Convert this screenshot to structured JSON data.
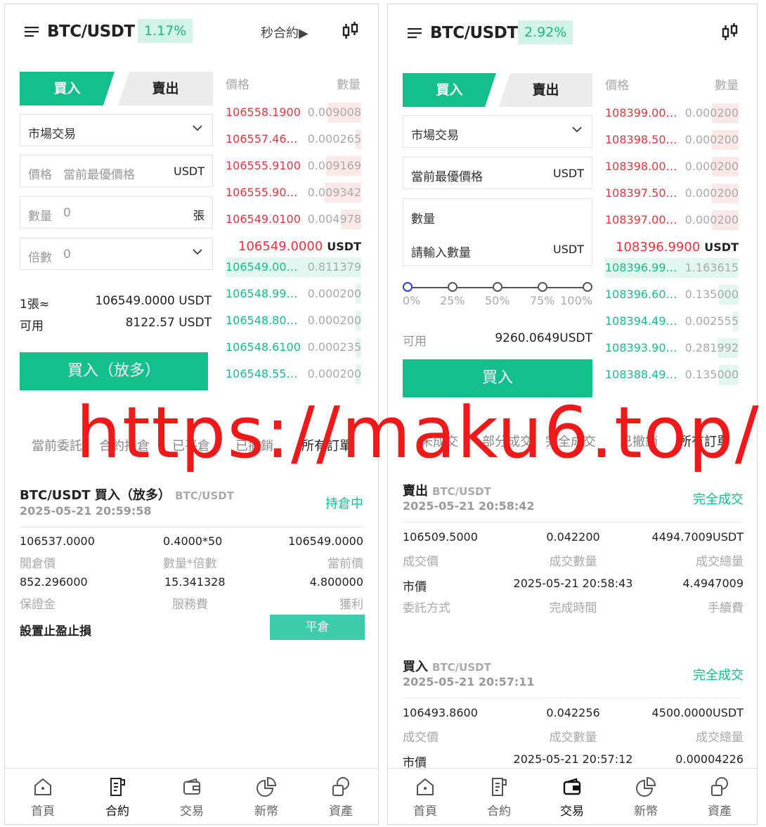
{
  "left": {
    "header": {
      "pair": "BTC/USDT",
      "change": "1.17%",
      "secondary": "秒合約",
      "secondary_arrow": "▶"
    },
    "tabs": {
      "buy": "買入",
      "sell": "賣出"
    },
    "form": {
      "order_type": "市場交易",
      "price_label": "價格",
      "price_value": "當前最優價格",
      "price_unit": "USDT",
      "qty_label": "數量",
      "qty_value": "0",
      "qty_unit": "張",
      "leverage_label": "倍數",
      "leverage_value": "0"
    },
    "info": {
      "lot_label": "1張≈",
      "lot_value": "106549.0000 USDT",
      "avail_label": "可用",
      "avail_value": "8122.57 USDT"
    },
    "submit": "買入（放多）",
    "orderbook": {
      "price_header": "價格",
      "qty_header": "數量",
      "asks": [
        {
          "price": "106558.1900",
          "qty": "0.009008",
          "depth": 0.25
        },
        {
          "price": "106557.46…",
          "qty": "0.000265",
          "depth": 0.04
        },
        {
          "price": "106555.9100",
          "qty": "0.009169",
          "depth": 0.26
        },
        {
          "price": "106555.90…",
          "qty": "0.009342",
          "depth": 0.27
        },
        {
          "price": "106549.0100",
          "qty": "0.004978",
          "depth": 0.15
        }
      ],
      "mid_price": "106549.0000",
      "mid_unit": "USDT",
      "bids": [
        {
          "price": "106549.00…",
          "qty": "0.811379",
          "depth": 1.0
        },
        {
          "price": "106548.99…",
          "qty": "0.000200",
          "depth": 0.03
        },
        {
          "price": "106548.80…",
          "qty": "0.000200",
          "depth": 0.03
        },
        {
          "price": "106548.6100",
          "qty": "0.000235",
          "depth": 0.03
        },
        {
          "price": "106548.55…",
          "qty": "0.000200",
          "depth": 0.03
        }
      ]
    },
    "subtabs": [
      "當前委託",
      "合約持倉",
      "已平倉",
      "已撤銷",
      "所有訂單"
    ],
    "order": {
      "title": "BTC/USDT 買入（放多）",
      "pair": "BTC/USDT",
      "date": "2025-05-21 20:59:58",
      "status": "持倉中",
      "r1": [
        "106537.0000",
        "0.4000*50",
        "106549.0000"
      ],
      "r1l": [
        "開倉價",
        "數量*倍數",
        "當前價"
      ],
      "r2": [
        "852.296000",
        "15.341328",
        "4.800000"
      ],
      "r2l": [
        "保證金",
        "服務費",
        "獲利"
      ],
      "tpsl": "設置止盈止損",
      "close": "平倉"
    },
    "nav": [
      "首頁",
      "合約",
      "交易",
      "新幣",
      "資產"
    ]
  },
  "right": {
    "header": {
      "pair": "BTC/USDT",
      "change": "2.92%"
    },
    "tabs": {
      "buy": "買入",
      "sell": "賣出"
    },
    "form": {
      "order_type": "市場交易",
      "price_value": "當前最優價格",
      "price_unit": "USDT",
      "qty_label": "數量",
      "qty_placeholder": "請輸入數量",
      "qty_unit": "USDT"
    },
    "slider": {
      "marks": [
        "0%",
        "25%",
        "50%",
        "75%",
        "100%"
      ],
      "value": 0
    },
    "info": {
      "avail_label": "可用",
      "avail_value": "9260.0649USDT"
    },
    "submit": "買入",
    "orderbook": {
      "price_header": "價格",
      "qty_header": "數量",
      "asks": [
        {
          "price": "108399.00…",
          "qty": "0.000200",
          "depth": 0.2
        },
        {
          "price": "108398.50…",
          "qty": "0.000200",
          "depth": 0.2
        },
        {
          "price": "108398.00…",
          "qty": "0.000200",
          "depth": 0.2
        },
        {
          "price": "108397.50…",
          "qty": "0.000200",
          "depth": 0.2
        },
        {
          "price": "108397.00…",
          "qty": "0.000200",
          "depth": 0.2
        }
      ],
      "mid_price": "108396.9900",
      "mid_unit": "USDT",
      "bids": [
        {
          "price": "108396.99…",
          "qty": "1.163615",
          "depth": 1.0
        },
        {
          "price": "108396.60…",
          "qty": "0.135000",
          "depth": 0.15
        },
        {
          "price": "108394.49…",
          "qty": "0.002555",
          "depth": 0.03
        },
        {
          "price": "108393.90…",
          "qty": "0.281992",
          "depth": 0.16
        },
        {
          "price": "108388.49…",
          "qty": "0.135000",
          "depth": 0.15
        }
      ]
    },
    "subtabs": [
      "未成交",
      "部分成交",
      "完全成交",
      "已撤銷",
      "所有訂單"
    ],
    "orders": [
      {
        "title": "賣出",
        "pair": "BTC/USDT",
        "date": "2025-05-21 20:58:42",
        "status": "完全成交",
        "r1": [
          "106509.5000",
          "0.042200",
          "4494.7009USDT"
        ],
        "r1l": [
          "成交價",
          "成交數量",
          "成交總量"
        ],
        "r2": [
          "市價",
          "2025-05-21 20:58:43",
          "4.4947009"
        ],
        "r2l": [
          "委託方式",
          "完成時間",
          "手續費"
        ]
      },
      {
        "title": "買入",
        "pair": "BTC/USDT",
        "date": "2025-05-21 20:57:11",
        "status": "完全成交",
        "r1": [
          "106493.8600",
          "0.042256",
          "4500.0000USDT"
        ],
        "r1l": [
          "成交價",
          "成交數量",
          "成交總量"
        ],
        "r2": [
          "市價",
          "2025-05-21 20:57:12",
          "0.00004226"
        ]
      }
    ],
    "nav": [
      "首頁",
      "合約",
      "交易",
      "新幣",
      "資產"
    ]
  },
  "watermark": "https://maku6.top/",
  "colors": {
    "green": "#13bf8a",
    "red": "#f0333c",
    "watermark": "#f01818"
  }
}
